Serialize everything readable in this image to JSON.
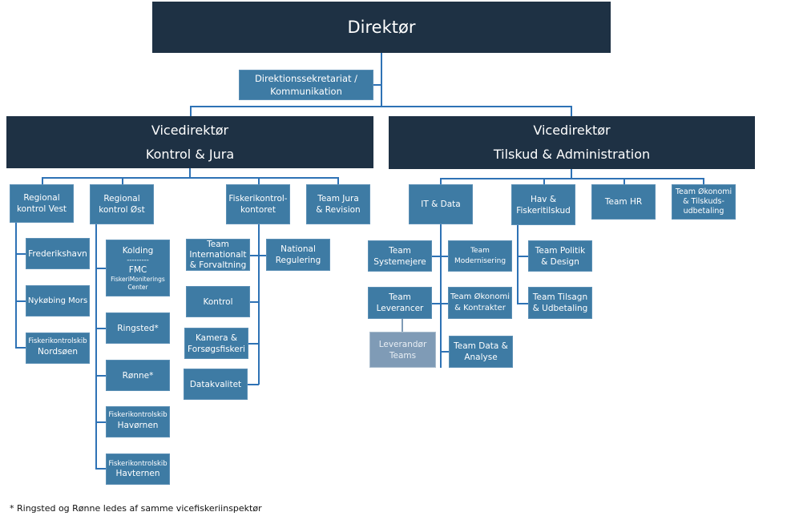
{
  "director": "Direktør",
  "secretariat": "Direktionssekretariat /\nKommunikation",
  "vice_left": {
    "title": "Vicedirektør",
    "area": "Kontrol & Jura"
  },
  "vice_right": {
    "title": "Vicedirektør",
    "area": "Tilskud & Administration"
  },
  "left_units": {
    "vest": "Regional\nkontrol Vest",
    "oest": "Regional\nkontrol Øst",
    "fiskerikontrol": "Fiskerikontrol-\nkontoret",
    "jura": "Team Jura\n& Revision"
  },
  "vest_children": {
    "frederikshavn": "Frederikshavn",
    "nykobing": "Nykøbing Mors",
    "nordsoen_type": "Fiskerikontrolskib",
    "nordsoen_name": "Nordsøen"
  },
  "oest_children": {
    "kolding": "Kolding",
    "kolding_sep": "---------",
    "fmc": "FMC",
    "fmc_full": "FiskeriMoniterings\nCenter",
    "ringsted": "Ringsted*",
    "ronne": "Rønne*",
    "havornen_type": "Fiskerikontrolskib",
    "havornen_name": "Havørnen",
    "havternen_type": "Fiskerikontrolskib",
    "havternen_name": "Havternen"
  },
  "fk_children": {
    "international": "Team\nInternationalt\n& Forvaltning",
    "national": "National\nRegulering",
    "kontrol": "Kontrol",
    "kamera": "Kamera &\nForsøgsfiskeri",
    "datakvalitet": "Datakvalitet"
  },
  "right_units": {
    "it": "IT & Data",
    "hav": "Hav &\nFiskeritilskud",
    "hr": "Team HR",
    "okonomi": "Team Økonomi\n& Tilskuds-\nudbetaling"
  },
  "it_children": {
    "systemejere": "Team\nSystemejere",
    "modernisering": "Team\nModernisering",
    "leverancer": "Team\nLeverancer",
    "okonomi_kontrakter": "Team Økonomi\n& Kontrakter",
    "data_analyse": "Team Data &\nAnalyse",
    "leverandor": "Leverandør\nTeams"
  },
  "hav_children": {
    "politik": "Team Politik\n&  Design",
    "tilsagn": "Team Tilsagn\n& Udbetaling"
  },
  "footnote": "* Ringsted og Rønne ledes af samme vicefiskeriinspektør",
  "colors": {
    "dark": "#1e3144",
    "box": "#3e7ba4",
    "light_box": "#7f9bb6",
    "connector": "#2e72b5"
  }
}
